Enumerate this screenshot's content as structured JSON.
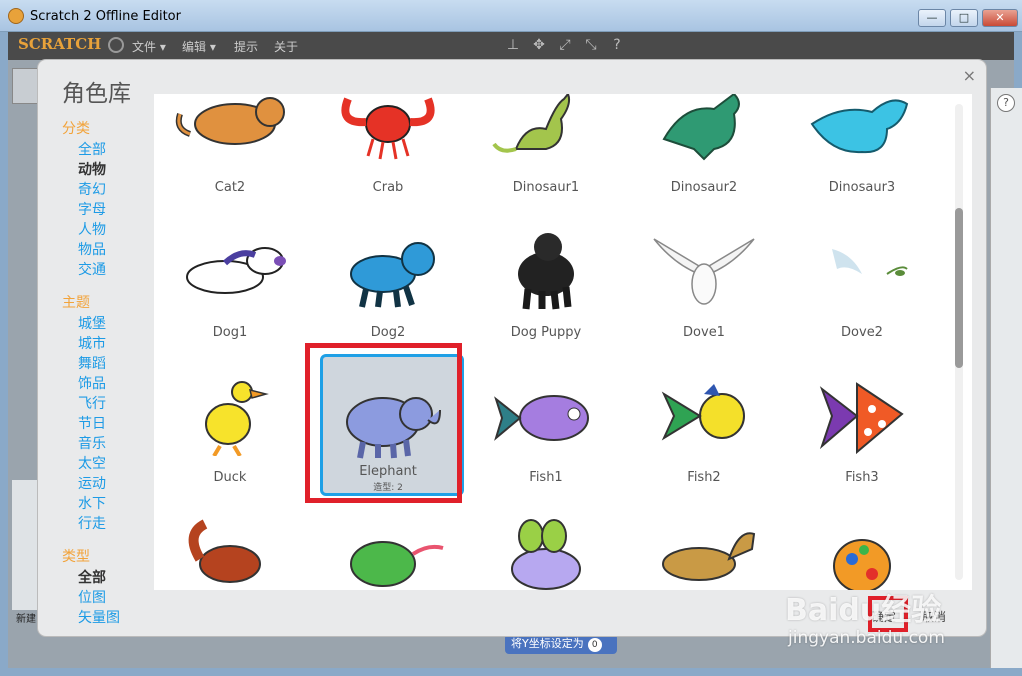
{
  "window": {
    "title": "Scratch 2 Offline Editor",
    "min": "—",
    "max": "□",
    "close": "✕"
  },
  "menubar": {
    "logo": "SCRATCH",
    "items": [
      "文件 ▾",
      "编辑 ▾",
      "提示",
      "关于"
    ]
  },
  "background": {
    "block_label": "将Y坐标设定为",
    "block_value": "0",
    "new_label": "新建"
  },
  "dialog": {
    "title": "角色库",
    "close": "×",
    "sections": [
      {
        "heading": "分类",
        "items": [
          "全部",
          "动物",
          "奇幻",
          "字母",
          "人物",
          "物品",
          "交通"
        ],
        "active": "动物"
      },
      {
        "heading": "主题",
        "items": [
          "城堡",
          "城市",
          "舞蹈",
          "饰品",
          "飞行",
          "节日",
          "音乐",
          "太空",
          "运动",
          "水下",
          "行走"
        ],
        "active": ""
      },
      {
        "heading": "类型",
        "items": [
          "全部",
          "位图",
          "矢量图"
        ],
        "active": "全部"
      }
    ],
    "sprites": [
      {
        "name": "Cat2"
      },
      {
        "name": "Crab"
      },
      {
        "name": "Dinosaur1"
      },
      {
        "name": "Dinosaur2"
      },
      {
        "name": "Dinosaur3"
      },
      {
        "name": "Dog1"
      },
      {
        "name": "Dog2"
      },
      {
        "name": "Dog Puppy"
      },
      {
        "name": "Dove1"
      },
      {
        "name": "Dove2"
      },
      {
        "name": "Duck"
      },
      {
        "name": "Elephant",
        "selected": true,
        "costumes": "造型: 2"
      },
      {
        "name": "Fish1"
      },
      {
        "name": "Fish2"
      },
      {
        "name": "Fish3"
      },
      {
        "name": ""
      },
      {
        "name": ""
      },
      {
        "name": ""
      },
      {
        "name": ""
      },
      {
        "name": ""
      }
    ],
    "ok": "确定",
    "cancel": "取消"
  },
  "watermark": {
    "main": "Baidu经验",
    "sub": "jingyan.baidu.com"
  }
}
